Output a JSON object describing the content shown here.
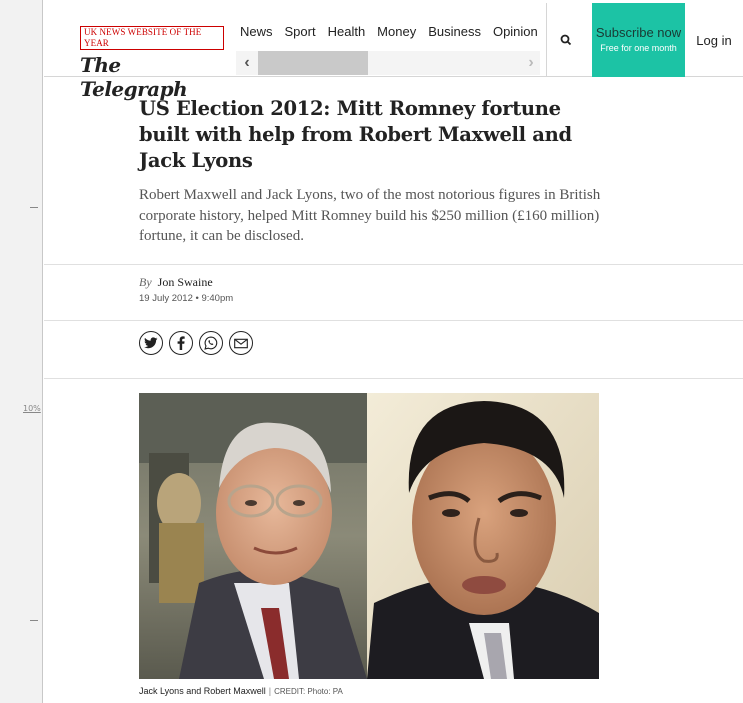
{
  "gutter": {
    "zoom_label": "10%"
  },
  "header": {
    "award": "UK NEWS WEBSITE OF THE YEAR",
    "logo": "The Telegraph",
    "nav": [
      "News",
      "Sport",
      "Health",
      "Money",
      "Business",
      "Opinion"
    ],
    "search_icon": "search-icon",
    "subscribe_label": "Subscribe now",
    "subscribe_sub": "Free for one month",
    "login_label": "Log in"
  },
  "article": {
    "headline": "US Election 2012: Mitt Romney fortune built with help from Robert Maxwell and Jack Lyons",
    "standfirst": "Robert Maxwell and Jack Lyons, two of the most notorious figures in British corporate history, helped Mitt Romney build his $250 million (£160 million) fortune, it can be disclosed.",
    "by_prefix": "By",
    "author": "Jon Swaine",
    "date": "19 July 2012 • 9:40pm",
    "share": [
      "twitter-icon",
      "facebook-icon",
      "whatsapp-icon",
      "email-icon"
    ],
    "caption": "Jack Lyons and Robert Maxwell",
    "caption_sep": "|",
    "credit": "CREDIT: Photo: PA"
  },
  "colors": {
    "accent": "#1cc3a5",
    "award_red": "#cc0000"
  }
}
